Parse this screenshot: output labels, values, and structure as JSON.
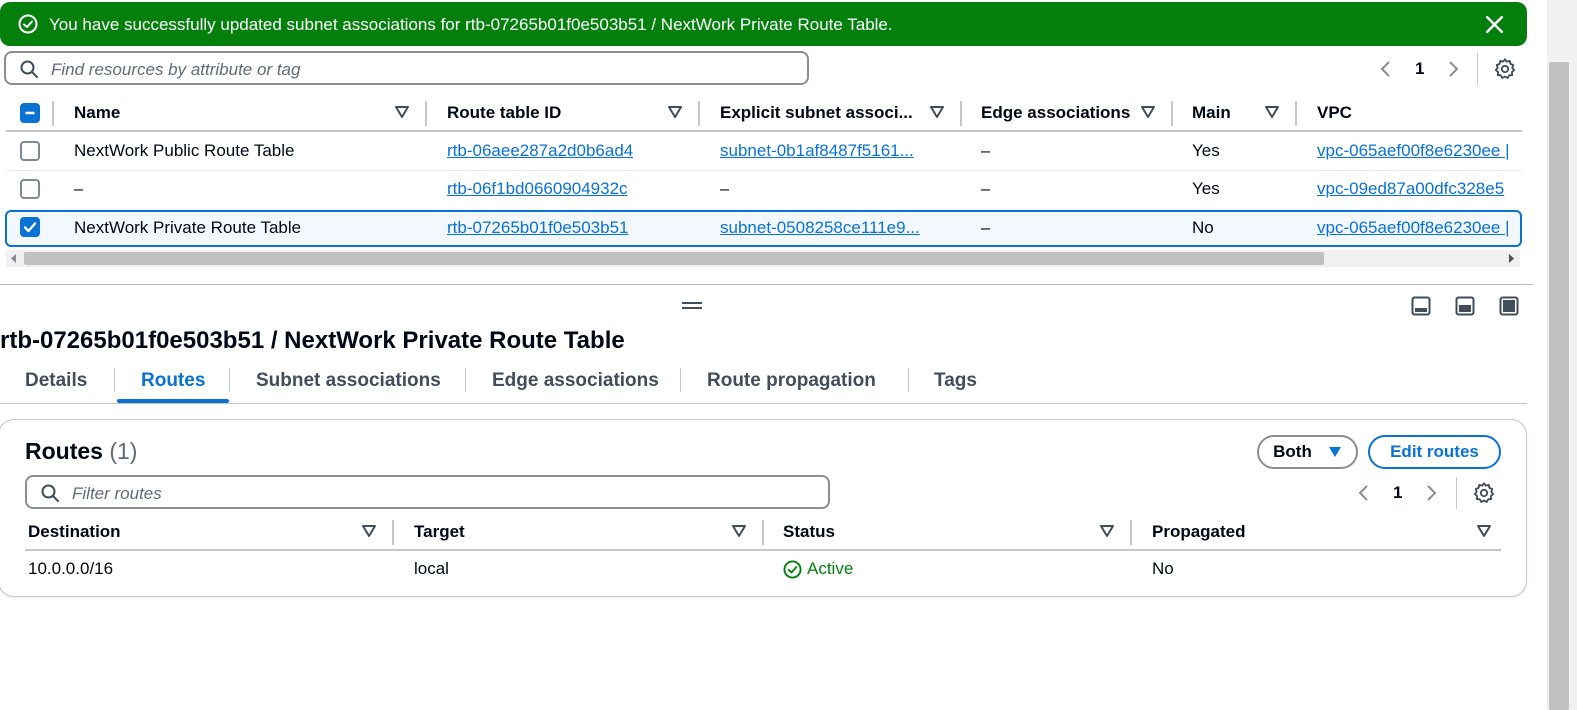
{
  "banner": {
    "message": "You have successfully updated subnet associations for rtb-07265b01f0e503b51 / NextWork Private Route Table.",
    "icon": "check-circle-icon",
    "close_icon": "close-icon",
    "color": "#037f0c"
  },
  "search": {
    "placeholder": "Find resources by attribute or tag"
  },
  "pagination": {
    "page": "1"
  },
  "table": {
    "columns": [
      "Name",
      "Route table ID",
      "Explicit subnet associ...",
      "Edge associations",
      "Main",
      "VPC"
    ],
    "rows": [
      {
        "selected": false,
        "name": "NextWork Public Route Table",
        "route_table_id": "rtb-06aee287a2d0b6ad4",
        "explicit_subnet": "subnet-0b1af8487f5161...",
        "edge": "–",
        "main": "Yes",
        "vpc": "vpc-065aef00f8e6230ee |"
      },
      {
        "selected": false,
        "name": "–",
        "route_table_id": "rtb-06f1bd0660904932c",
        "explicit_subnet": "–",
        "edge": "–",
        "main": "Yes",
        "vpc": "vpc-09ed87a00dfc328e5"
      },
      {
        "selected": true,
        "name": "NextWork Private Route Table",
        "route_table_id": "rtb-07265b01f0e503b51",
        "explicit_subnet": "subnet-0508258ce111e9...",
        "edge": "–",
        "main": "No",
        "vpc": "vpc-065aef00f8e6230ee |"
      }
    ]
  },
  "details": {
    "title": "rtb-07265b01f0e503b51 / NextWork Private Route Table",
    "tabs": [
      "Details",
      "Routes",
      "Subnet associations",
      "Edge associations",
      "Route propagation",
      "Tags"
    ],
    "active_tab": "Routes"
  },
  "routes": {
    "title": "Routes",
    "count": "(1)",
    "both_label": "Both",
    "edit_label": "Edit routes",
    "filter_placeholder": "Filter routes",
    "page": "1",
    "columns": [
      "Destination",
      "Target",
      "Status",
      "Propagated"
    ],
    "rows": [
      {
        "destination": "10.0.0.0/16",
        "target": "local",
        "status": "Active",
        "propagated": "No"
      }
    ],
    "status_color": "#037f0c"
  },
  "accent": "#0972d3"
}
